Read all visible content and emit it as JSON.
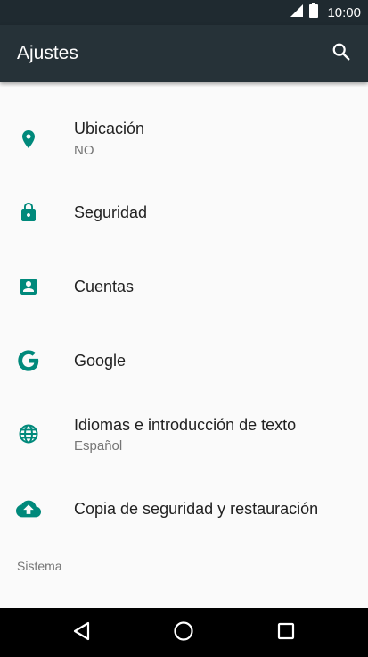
{
  "status_bar": {
    "time": "10:00"
  },
  "app_bar": {
    "title": "Ajustes",
    "search_icon": "search-icon"
  },
  "colors": {
    "accent": "#00897b",
    "app_bar": "#263238",
    "status_bar": "#1f2a30",
    "background": "#fafafa"
  },
  "settings": [
    {
      "title": "Ubicación",
      "subtitle": "NO",
      "icon": "location-icon"
    },
    {
      "title": "Seguridad",
      "icon": "lock-icon"
    },
    {
      "title": "Cuentas",
      "icon": "account-box-icon"
    },
    {
      "title": "Google",
      "icon": "google-icon"
    },
    {
      "title": "Idiomas e introducción de texto",
      "subtitle": "Español",
      "icon": "globe-icon"
    },
    {
      "title": "Copia de seguridad y restauración",
      "icon": "cloud-upload-icon"
    }
  ],
  "section_header": "Sistema",
  "nav_bar": {
    "back_icon": "back-icon",
    "home_icon": "home-icon",
    "recents_icon": "recents-icon"
  }
}
